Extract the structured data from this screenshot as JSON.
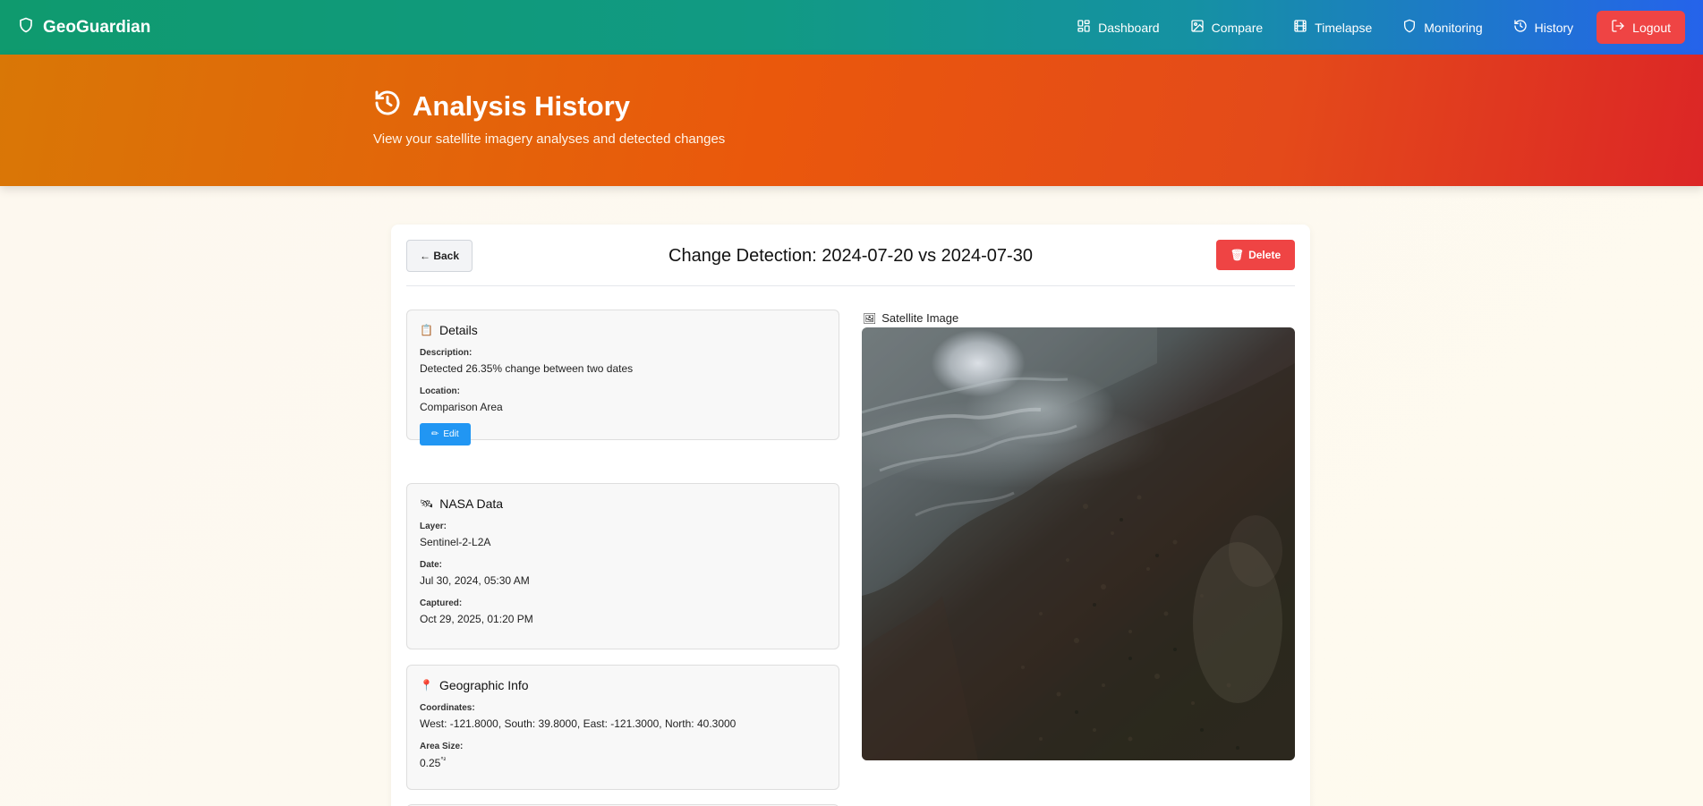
{
  "nav": {
    "brand": "GeoGuardian",
    "links": [
      {
        "label": "Dashboard",
        "icon": "dashboard-icon"
      },
      {
        "label": "Compare",
        "icon": "image-icon"
      },
      {
        "label": "Timelapse",
        "icon": "film-icon"
      },
      {
        "label": "Monitoring",
        "icon": "shield-icon"
      },
      {
        "label": "History",
        "icon": "history-icon"
      }
    ],
    "logout": "Logout"
  },
  "hero": {
    "title": "Analysis History",
    "subtitle": "View your satellite imagery analyses and detected changes"
  },
  "detail": {
    "back_label": "← Back",
    "title": "Change Detection: 2024-07-20 vs 2024-07-30",
    "delete_label": "Delete",
    "delete_icon": "🗑",
    "details": {
      "heading": "Details",
      "icon": "📋",
      "description_label": "Description:",
      "description": "Detected 26.35% change between two dates",
      "location_label": "Location:",
      "location": "Comparison Area",
      "edit_label": "Edit",
      "edit_icon": "✏"
    },
    "nasa": {
      "heading": "NASA Data",
      "icon": "🛰",
      "layer_label": "Layer:",
      "layer": "Sentinel-2-L2A",
      "date_label": "Date:",
      "date": "Jul 30, 2024, 05:30 AM",
      "captured_label": "Captured:",
      "captured": "Oct 29, 2025, 01:20 PM"
    },
    "geo": {
      "heading": "Geographic Info",
      "icon": "📍",
      "coordinates_label": "Coordinates:",
      "coordinates": "West: -121.8000, South: 39.8000, East: -121.3000, North: 40.3000",
      "area_label": "Area Size:",
      "area_value": "0.25",
      "area_unit": "°²"
    },
    "satellite_label": "Satellite Image",
    "satellite_icon": "🖼"
  },
  "colors": {
    "nav_start": "#0f9a6e",
    "nav_end": "#2563eb",
    "hero_start": "#d97706",
    "hero_end": "#dc2626",
    "logout": "#ef4444",
    "delete": "#ef4444",
    "edit": "#2196f3"
  }
}
